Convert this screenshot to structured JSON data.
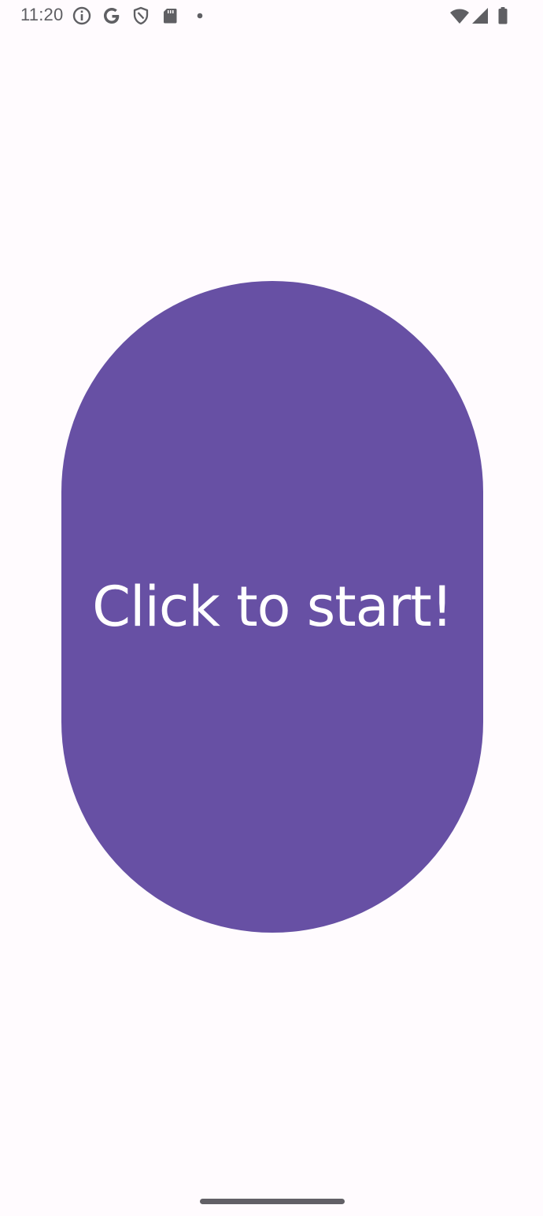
{
  "status_bar": {
    "time": "11:20",
    "icons": [
      "info-icon",
      "google-icon",
      "shield-icon",
      "sd-card-icon",
      "notification-dot-icon",
      "wifi-icon",
      "cell-signal-icon",
      "battery-icon"
    ],
    "icon_color": "#5f5f63"
  },
  "main": {
    "start_button_label": "Click to start!",
    "button_color": "#6750A4",
    "label_color": "#FFFFFF",
    "background_color": "#FFFBFE"
  },
  "nav": {
    "handle_color": "#626066"
  }
}
